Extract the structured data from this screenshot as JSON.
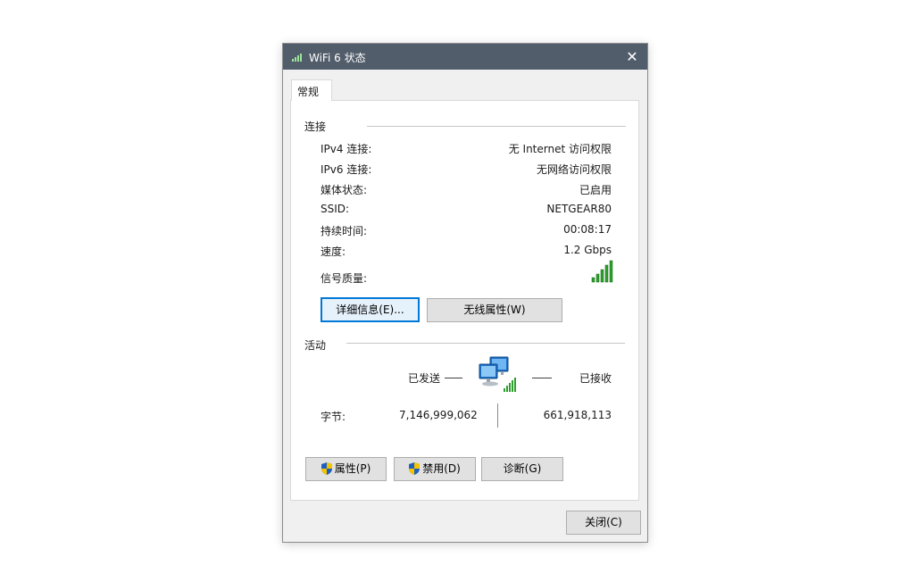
{
  "window": {
    "title": "WiFi 6 状态",
    "close_glyph": "✕"
  },
  "tabs": [
    {
      "label": "常规"
    }
  ],
  "connection": {
    "group_label": "连接",
    "rows": [
      {
        "label": "IPv4 连接:",
        "value": "无 Internet 访问权限"
      },
      {
        "label": "IPv6 连接:",
        "value": "无网络访问权限"
      },
      {
        "label": "媒体状态:",
        "value": "已启用"
      },
      {
        "label": "SSID:",
        "value": "NETGEAR80"
      },
      {
        "label": "持续时间:",
        "value": "00:08:17"
      },
      {
        "label": "速度:",
        "value": "1.2 Gbps"
      }
    ],
    "signal_label": "信号质量:",
    "signal_icon": "signal-bars-icon",
    "details_button": "详细信息(E)...",
    "wireless_props_button": "无线属性(W)"
  },
  "activity": {
    "group_label": "活动",
    "sent_label": "已发送",
    "received_label": "已接收",
    "bytes_label": "字节:",
    "bytes_sent": "7,146,999,062",
    "bytes_received": "661,918,113",
    "network_icon": "network-computers-icon"
  },
  "actions": {
    "properties_button": "属性(P)",
    "disable_button": "禁用(D)",
    "diagnose_button": "诊断(G)"
  },
  "footer": {
    "close_button": "关闭(C)"
  },
  "colors": {
    "titlebar": "#525d6b",
    "signal_green": "#2e9e2e",
    "focus_blue": "#0078d7"
  }
}
